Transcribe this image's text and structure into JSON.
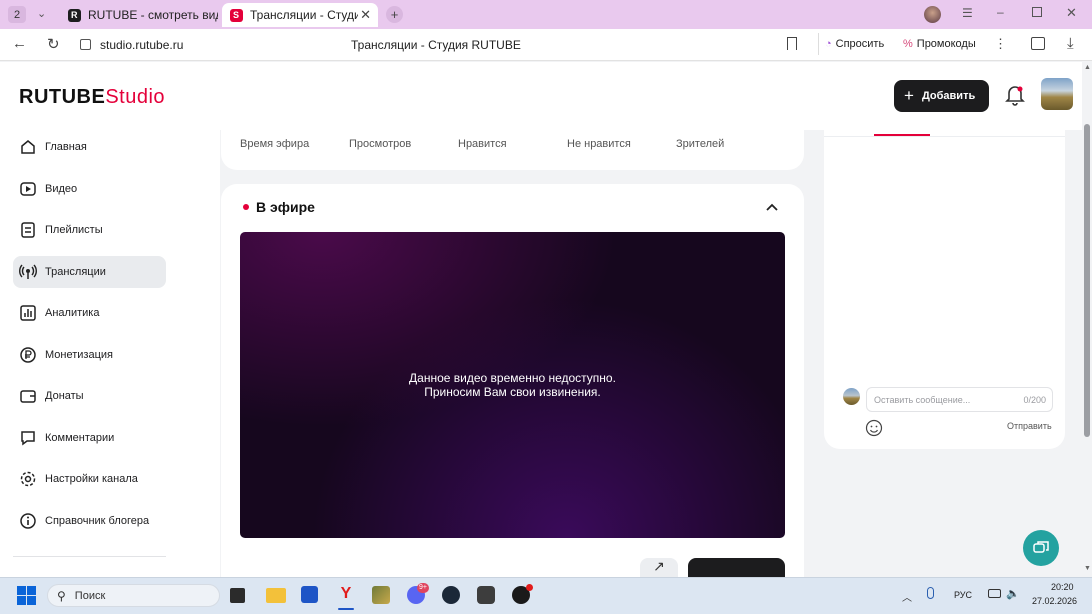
{
  "browser": {
    "tab_count": "2",
    "tabs": [
      {
        "title": "RUTUBE - смотреть виде"
      },
      {
        "title": "Трансляции - Студия R"
      }
    ],
    "url": "studio.rutube.ru",
    "page_title": "Трансляции - Студия RUTUBE",
    "ask_label": "Спросить",
    "promo_label": "Промокоды"
  },
  "header": {
    "logo_main": "RUTUBE",
    "logo_accent": "Studio",
    "add_label": "Добавить"
  },
  "sidebar": {
    "items": [
      {
        "label": "Главная",
        "icon": "home-icon"
      },
      {
        "label": "Видео",
        "icon": "video-icon"
      },
      {
        "label": "Плейлисты",
        "icon": "playlist-icon"
      },
      {
        "label": "Трансляции",
        "icon": "broadcast-icon",
        "active": true
      },
      {
        "label": "Аналитика",
        "icon": "analytics-icon"
      },
      {
        "label": "Монетизация",
        "icon": "monetization-icon"
      },
      {
        "label": "Донаты",
        "icon": "wallet-icon"
      },
      {
        "label": "Комментарии",
        "icon": "comments-icon"
      },
      {
        "label": "Настройки канала",
        "icon": "settings-icon"
      },
      {
        "label": "Справочник блогера",
        "icon": "info-icon"
      }
    ]
  },
  "stats": {
    "labels": [
      "Время эфира",
      "Просмотров",
      "Нравится",
      "Не нравится",
      "Зрителей"
    ]
  },
  "live": {
    "title": "В эфире",
    "video_message_line1": "Данное видео временно недоступно.",
    "video_message_line2": "Приносим Вам свои извинения."
  },
  "chat": {
    "placeholder": "Оставить сообщение...",
    "counter": "0/200",
    "send_label": "Отправить"
  },
  "taskbar": {
    "search_placeholder": "Поиск",
    "lang": "РУС",
    "time": "20:20",
    "date": "27.02.2026",
    "badge": "9+"
  },
  "colors": {
    "accent": "#e4003a",
    "dark_button": "#1c1c1e",
    "tabbar": "#e9c9ee",
    "support": "#24a2a0"
  }
}
